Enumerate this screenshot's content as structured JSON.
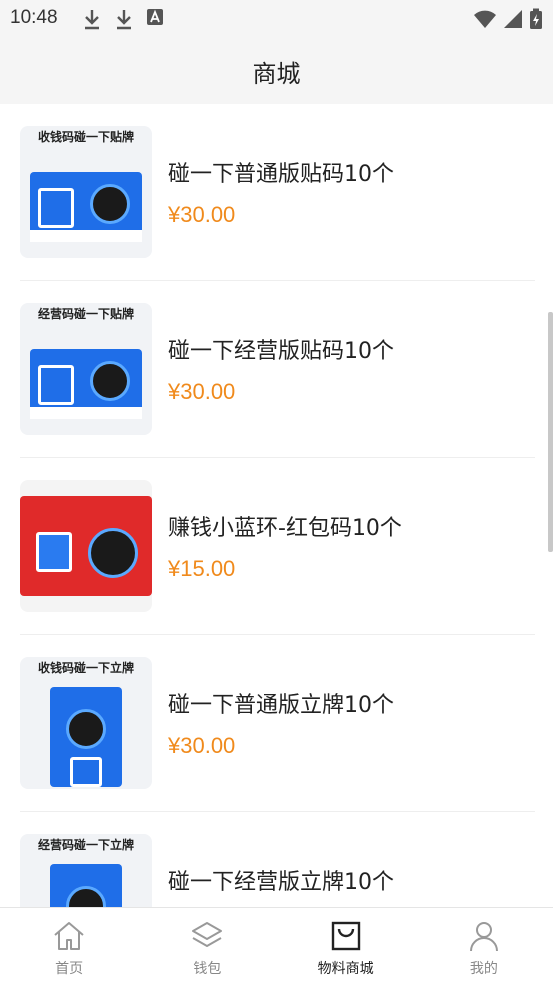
{
  "status_bar": {
    "time": "10:48"
  },
  "header": {
    "title": "商城"
  },
  "products": [
    {
      "thumb_caption": "收钱码碰一下贴牌",
      "name": "碰一下普通版贴码10个",
      "price": "¥30.00",
      "style": "blue"
    },
    {
      "thumb_caption": "经营码碰一下贴牌",
      "name": "碰一下经营版贴码10个",
      "price": "¥30.00",
      "style": "blue"
    },
    {
      "thumb_caption": "",
      "name": "赚钱小蓝环-红包码10个",
      "price": "¥15.00",
      "style": "red"
    },
    {
      "thumb_caption": "收钱码碰一下立牌",
      "name": "碰一下普通版立牌10个",
      "price": "¥30.00",
      "style": "stand"
    },
    {
      "thumb_caption": "经营码碰一下立牌",
      "name": "碰一下经营版立牌10个",
      "price": "",
      "style": "stand"
    }
  ],
  "tabbar": {
    "tabs": [
      {
        "label": "首页",
        "icon": "home-icon",
        "active": false
      },
      {
        "label": "钱包",
        "icon": "layers-icon",
        "active": false
      },
      {
        "label": "物料商城",
        "icon": "bag-icon",
        "active": true
      },
      {
        "label": "我的",
        "icon": "user-icon",
        "active": false
      }
    ]
  },
  "colors": {
    "price": "#f08a1c",
    "accent_blue": "#1f6ee8",
    "accent_red": "#e02a2a"
  }
}
